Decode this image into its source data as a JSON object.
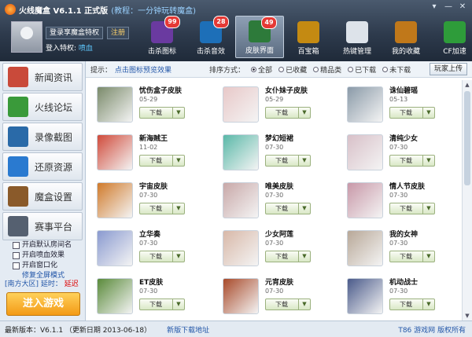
{
  "window": {
    "title": "火线魔盒 V6.1.1 正式版",
    "tip": "(教程：一分钟玩转魔盒)",
    "controls": [
      "▾",
      "—",
      "✕"
    ]
  },
  "user": {
    "login_label": "登录享魔盒特权",
    "register_label": "注册",
    "privilege_label": "登入特权:",
    "privilege_value": "喷血"
  },
  "toolbar": [
    {
      "label": "击杀图标",
      "badge": "99",
      "color": "#6a3aa0",
      "icon": "kill-icon"
    },
    {
      "label": "击杀音效",
      "badge": "28",
      "color": "#1d6fb8",
      "icon": "music-icon"
    },
    {
      "label": "皮肤界面",
      "badge": "49",
      "color": "#2d7a3a",
      "icon": "skin-icon"
    },
    {
      "label": "百宝箱",
      "badge": "",
      "color": "#c48a12",
      "icon": "toolbox-icon"
    },
    {
      "label": "热键管理",
      "badge": "",
      "color": "#dde3ea",
      "icon": "keyboard-icon"
    },
    {
      "label": "我的收藏",
      "badge": "",
      "color": "#c0781a",
      "icon": "favorites-icon"
    },
    {
      "label": "CF加速",
      "badge": "",
      "color": "#2e9c3a",
      "icon": "speedup-icon"
    }
  ],
  "sidebar": {
    "items": [
      {
        "label": "新闻资讯",
        "color": "#c94a3a",
        "icon": "news-icon"
      },
      {
        "label": "火线论坛",
        "color": "#3a9a3a",
        "icon": "forum-icon"
      },
      {
        "label": "录像截图",
        "color": "#2a6aa8",
        "icon": "video-icon"
      },
      {
        "label": "还原资源",
        "color": "#2a7ad0",
        "icon": "restore-icon"
      },
      {
        "label": "魔盒设置",
        "color": "#8a5a2a",
        "icon": "settings-icon"
      },
      {
        "label": "赛事平台",
        "color": "#556070",
        "icon": "gamepad-icon"
      }
    ],
    "options": [
      "开启默认房间名",
      "开启喷血效果",
      "开启窗口化"
    ],
    "restore_link": "修复全屏模式",
    "server_prefix": "[南方大区]",
    "server_latency": "延时：",
    "server_status": "延迟",
    "enter_label": "进入游戏"
  },
  "filter": {
    "hint_label": "提示：",
    "hint_link": "点击图标预览效果",
    "sort_label": "排序方式：",
    "options": [
      {
        "label": "全部",
        "checked": true
      },
      {
        "label": "已收藏",
        "checked": false
      },
      {
        "label": "精品类",
        "checked": false
      },
      {
        "label": "已下载",
        "checked": false
      },
      {
        "label": "未下载",
        "checked": false
      }
    ],
    "upload_label": "玩家上传"
  },
  "skins": [
    {
      "name": "忧伤盒子皮肤",
      "date": "05-29",
      "color": "#7a8a6a"
    },
    {
      "name": "女仆妹子皮肤",
      "date": "05-29",
      "color": "#e8c8c8"
    },
    {
      "name": "诛仙碧瑶",
      "date": "05-13",
      "color": "#8a9aa8"
    },
    {
      "name": "新海贼王",
      "date": "11-02",
      "color": "#d04a3a"
    },
    {
      "name": "梦幻短裙",
      "date": "07-30",
      "color": "#5ab8a8"
    },
    {
      "name": "清纯少女",
      "date": "07-30",
      "color": "#d8c0c8"
    },
    {
      "name": "宇宙皮肤",
      "date": "07-30",
      "color": "#d07a2a"
    },
    {
      "name": "唯美皮肤",
      "date": "07-30",
      "color": "#c8a8a8"
    },
    {
      "name": "情人节皮肤",
      "date": "07-30",
      "color": "#c898a8"
    },
    {
      "name": "立华奏",
      "date": "07-30",
      "color": "#8a9ad0"
    },
    {
      "name": "少女阿莲",
      "date": "07-30",
      "color": "#d8b8a8"
    },
    {
      "name": "我的女神",
      "date": "07-30",
      "color": "#b8a898"
    },
    {
      "name": "ET皮肤",
      "date": "07-30",
      "color": "#5a8a3a"
    },
    {
      "name": "元宵皮肤",
      "date": "07-30",
      "color": "#a84a2a"
    },
    {
      "name": "机动战士",
      "date": "07-30",
      "color": "#4a5a8a"
    }
  ],
  "download_label": "下载",
  "footer": {
    "version": "最新版本：V6.1.1 （更新日期 2013-06-18）",
    "new_download": "新版下载地址",
    "right": "T86 游戏网 版权所有"
  }
}
